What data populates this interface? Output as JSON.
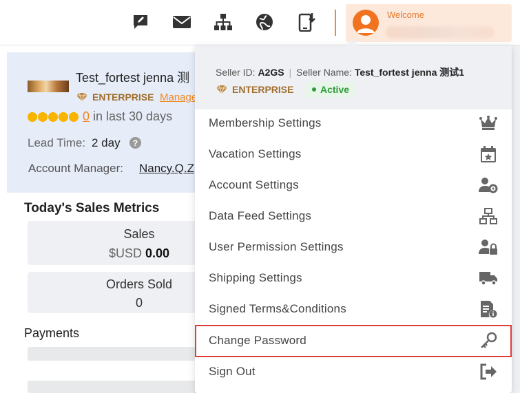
{
  "topbar": {
    "icons": [
      {
        "name": "messages-edit-icon"
      },
      {
        "name": "mail-icon"
      },
      {
        "name": "sitemap-icon"
      },
      {
        "name": "globe-icon"
      },
      {
        "name": "mobile-download-icon"
      }
    ],
    "welcome_label": "Welcome",
    "accent_color": "#f08a24"
  },
  "profile": {
    "shop_name": "Test_fortest jenna 测",
    "tier": "ENTERPRISE",
    "manage_link": "Manage",
    "rating_count": "0",
    "rating_suffix": "in last 30 days",
    "lead_time_label": "Lead Time:",
    "lead_time_value": "2 day",
    "help_glyph": "?",
    "account_manager_label": "Account Manager:",
    "account_manager_value": "Nancy.Q.Z"
  },
  "metrics": {
    "title": "Today's Sales Metrics",
    "sales_label": "Sales",
    "sales_currency": "$USD",
    "sales_value": "0.00",
    "orders_label": "Orders Sold",
    "orders_value": "0"
  },
  "payments": {
    "title": "Payments"
  },
  "dropdown": {
    "seller_id_label": "Seller ID:",
    "seller_id_value": "A2GS",
    "separator": "|",
    "seller_name_label": "Seller Name:",
    "seller_name_value": "Test_fortest jenna 测试1",
    "tier": "ENTERPRISE",
    "status": "Active",
    "items": [
      {
        "label": "Membership Settings",
        "icon": "crown-icon"
      },
      {
        "label": "Vacation Settings",
        "icon": "calendar-star-icon"
      },
      {
        "label": "Account Settings",
        "icon": "user-gear-icon"
      },
      {
        "label": "Data Feed Settings",
        "icon": "sitemap-icon"
      },
      {
        "label": "User Permission Settings",
        "icon": "user-lock-icon"
      },
      {
        "label": "Shipping Settings",
        "icon": "truck-icon"
      },
      {
        "label": "Signed Terms&Conditions",
        "icon": "document-info-icon"
      },
      {
        "label": "Change Password",
        "icon": "key-icon"
      },
      {
        "label": "Sign Out",
        "icon": "sign-out-icon"
      }
    ]
  }
}
